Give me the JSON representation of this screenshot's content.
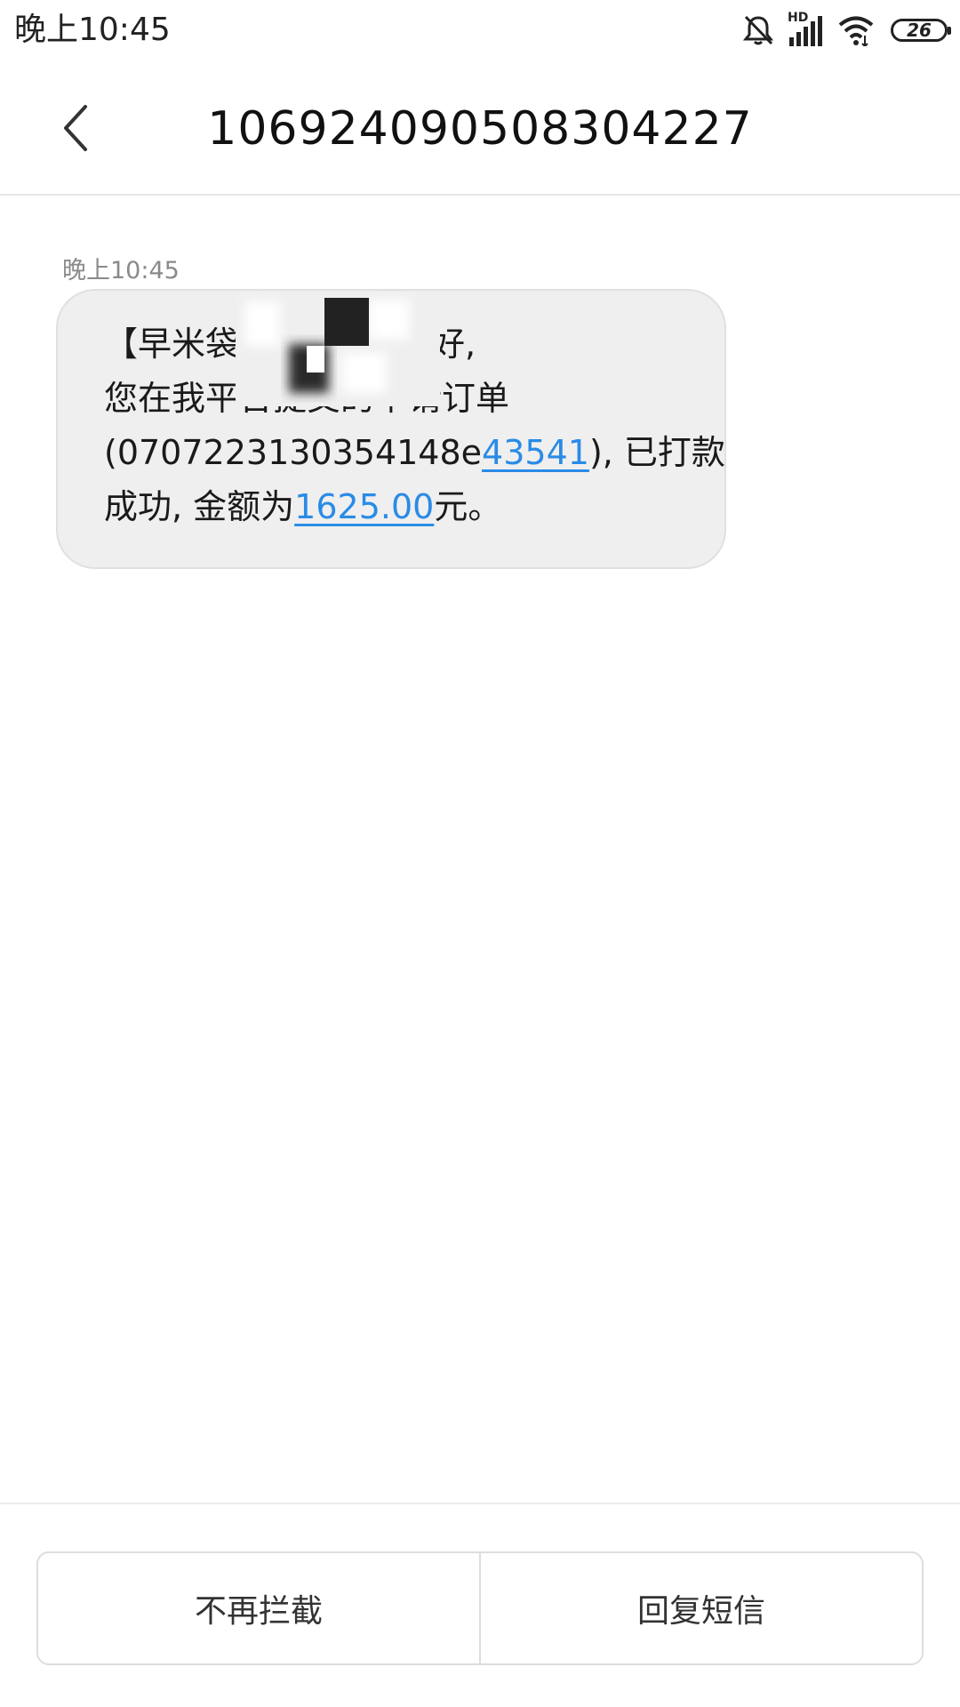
{
  "status_bar": {
    "time": "晚上10:45",
    "network_label": "HD",
    "battery_level": "26",
    "icons": [
      "silent-bell-icon",
      "hd-signal-icon",
      "wifi-icon",
      "battery-icon"
    ]
  },
  "header": {
    "title": "10692409050830 4227",
    "back_icon": "chevron-left-icon"
  },
  "message": {
    "timestamp": "晚上10:45",
    "line1_prefix": "【早米袋】",
    "line1_suffix": "您好,",
    "line2": "您在我平台提交的申请订单",
    "line3_prefix": "(0707223130354148e",
    "line3_link": "43541",
    "line3_suffix": "), 已打款",
    "line4_prefix": "成功, 金额为",
    "line4_link": "1625.00",
    "line4_suffix": "元。"
  },
  "actions": {
    "unblock_label": "不再拦截",
    "reply_label": "回复短信"
  },
  "colors": {
    "link": "#2a8be6",
    "bubble_bg": "#efefef",
    "divider": "#e6e6e6"
  }
}
